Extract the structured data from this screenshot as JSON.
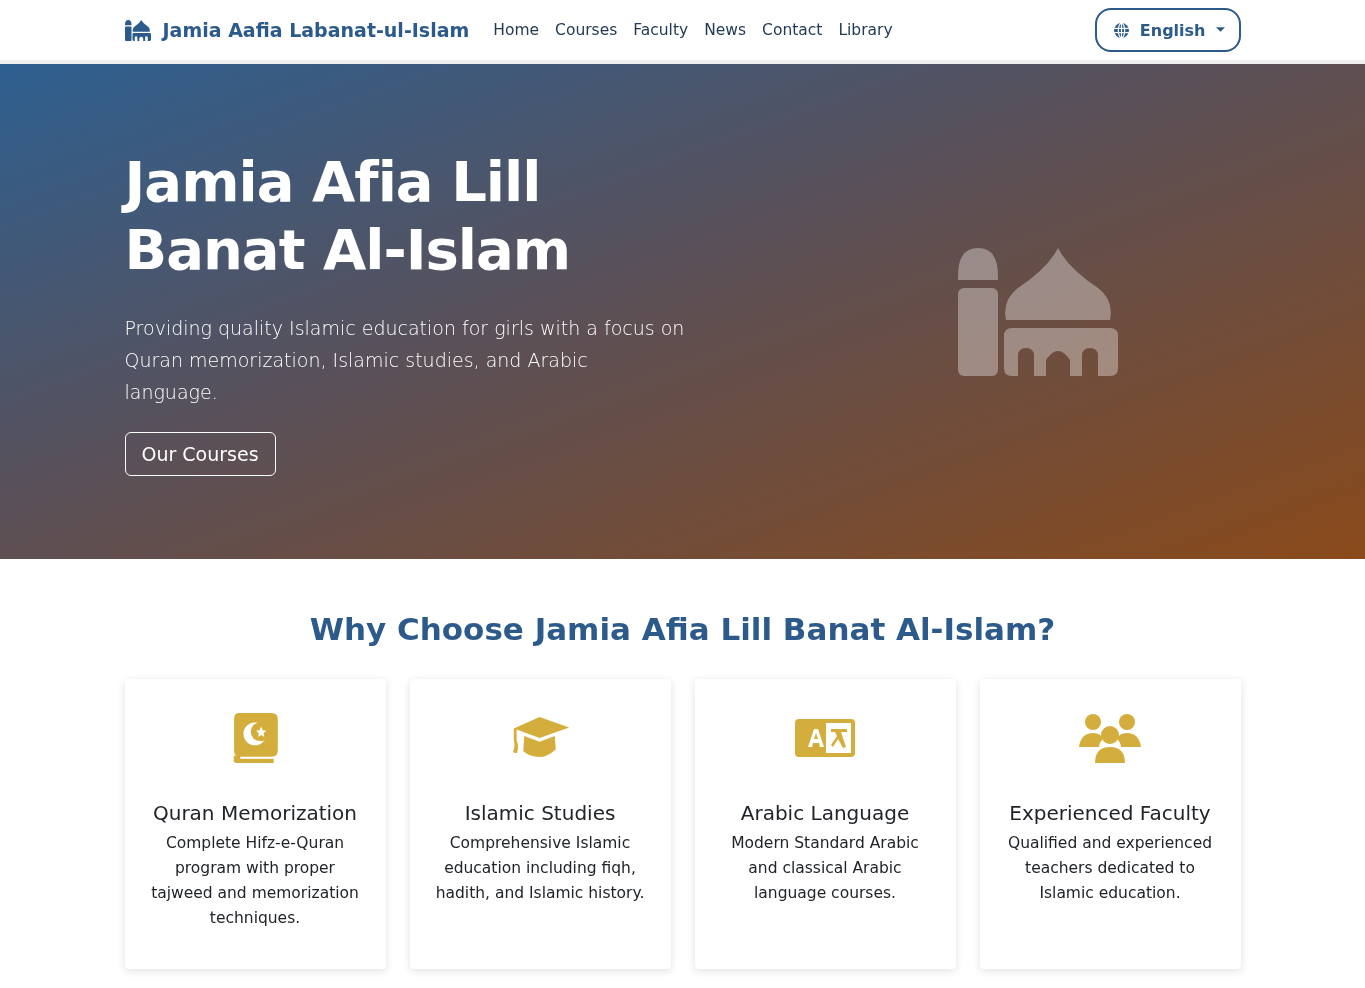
{
  "navbar": {
    "brand": "Jamia Aafia Labanat-ul-Islam",
    "links": [
      "Home",
      "Courses",
      "Faculty",
      "News",
      "Contact",
      "Library"
    ],
    "language_button": "English"
  },
  "hero": {
    "title_lines": [
      "Jamia Afia Lill",
      "Banat Al-Islam"
    ],
    "lead": "Providing quality Islamic education for girls with a focus on Quran memorization, Islamic studies, and Arabic language.",
    "button": "Our Courses"
  },
  "features": {
    "heading": "Why Choose Jamia Afia Lill Banat Al-Islam?",
    "cards": [
      {
        "kind": "quran",
        "title": "Quran Memorization",
        "text": "Complete Hifz-e-Quran program with proper tajweed and memorization techniques."
      },
      {
        "kind": "graduation",
        "title": "Islamic Studies",
        "text": "Comprehensive Islamic education including fiqh, hadith, and Islamic history."
      },
      {
        "kind": "language",
        "title": "Arabic Language",
        "text": "Modern Standard Arabic and classical Arabic language courses."
      },
      {
        "kind": "people",
        "title": "Experienced Faculty",
        "text": "Qualified and experienced teachers dedicated to Islamic education."
      }
    ]
  }
}
